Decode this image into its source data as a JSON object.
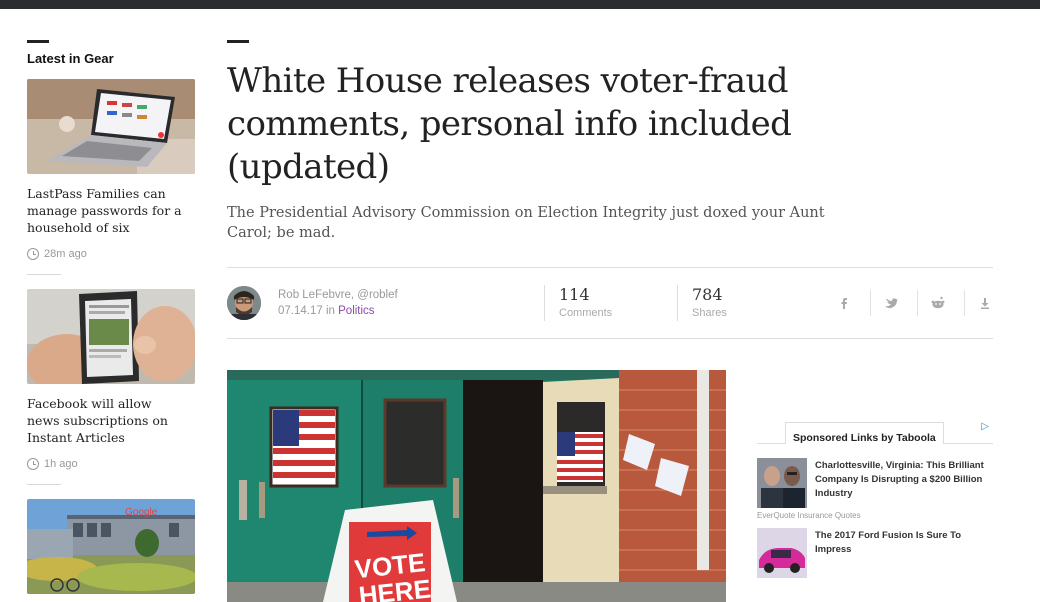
{
  "sidebar": {
    "heading": "Latest in Gear",
    "items": [
      {
        "title": "LastPass Families can manage passwords for a household of six",
        "time": "28m ago"
      },
      {
        "title": "Facebook will allow news subscriptions on Instant Articles",
        "time": "1h ago"
      },
      {
        "title": "",
        "time": ""
      }
    ]
  },
  "article": {
    "headline": "White House releases voter-fraud comments, personal info included (updated)",
    "dek": "The Presidential Advisory Commission on Election Integrity just doxed your Aunt Carol; be mad.",
    "author": "Rob LeFebvre, @roblef",
    "date": "07.14.17",
    "date_in": "in",
    "category": "Politics",
    "comments_count": "114",
    "comments_label": "Comments",
    "shares_count": "784",
    "shares_label": "Shares",
    "share_icons": [
      "facebook-icon",
      "twitter-icon",
      "reddit-icon",
      "download-icon"
    ],
    "hero_sign": [
      "VOTE",
      "HERE"
    ]
  },
  "taboola": {
    "label": "Sponsored Links by Taboola",
    "items": [
      {
        "title": "Charlottesville, Virginia: This Brilliant Company Is Disrupting a $200 Billion Industry",
        "source": "EverQuote Insurance Quotes"
      },
      {
        "title": "The 2017 Ford Fusion Is Sure To Impress",
        "source": ""
      }
    ]
  },
  "colors": {
    "accent": "#8a4aa6",
    "topbar": "#2b2d31",
    "adchoice": "#1a8fd1"
  }
}
